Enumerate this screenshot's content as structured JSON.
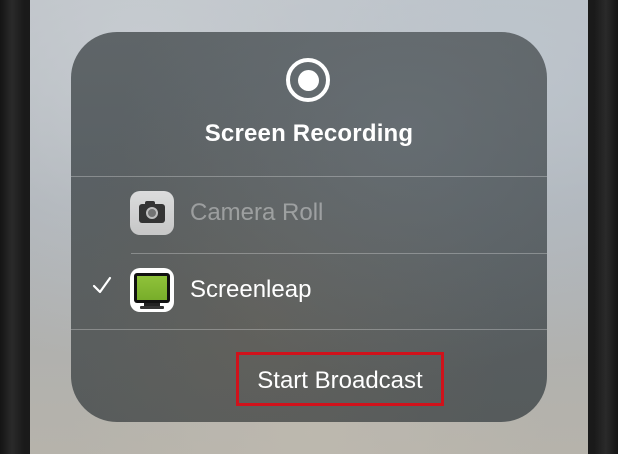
{
  "panel": {
    "title": "Screen Recording",
    "record_icon": "record-icon"
  },
  "options": [
    {
      "label": "Camera Roll",
      "icon": "camera-icon",
      "selected": false,
      "enabled": false
    },
    {
      "label": "Screenleap",
      "icon": "screenleap-icon",
      "selected": true,
      "enabled": true
    }
  ],
  "checkmark_glyph": "checkmark-icon",
  "action": {
    "label": "Start Broadcast",
    "highlight_color": "#d0121b"
  },
  "colors": {
    "panel_bg": "#595f62",
    "text": "#ffffff",
    "disabled_text": "rgba(255,255,255,0.38)",
    "screenleap_green": "#8fc23a"
  }
}
